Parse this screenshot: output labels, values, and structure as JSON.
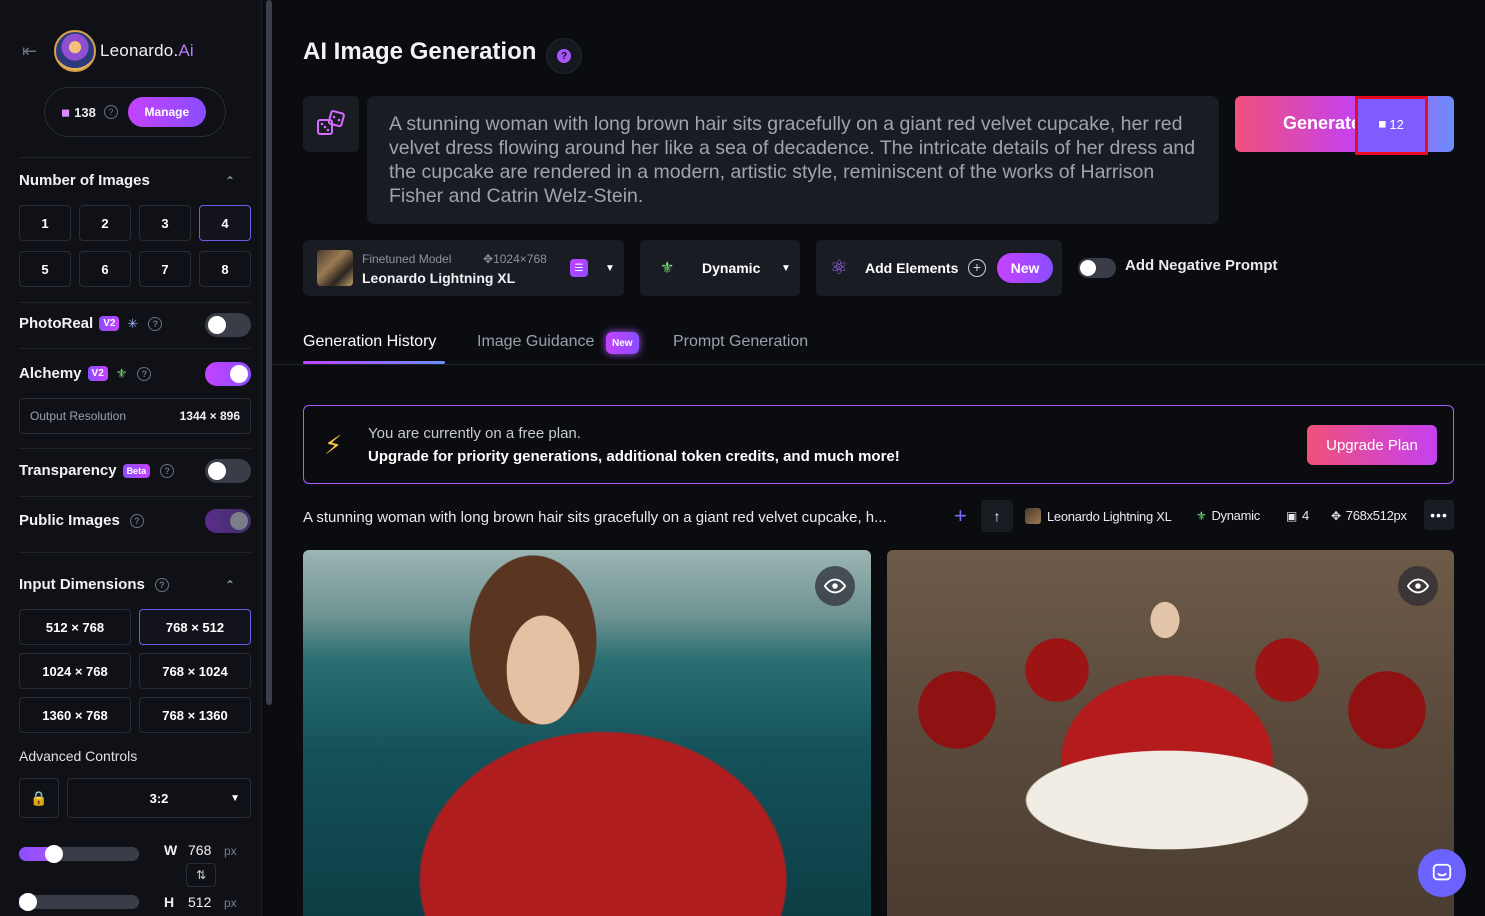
{
  "sidebar": {
    "brand": {
      "name": "Leonardo.",
      "suffix": "Ai"
    },
    "tokens": {
      "count": "138",
      "manage_label": "Manage"
    },
    "number_of_images": {
      "title": "Number of Images",
      "options": [
        "1",
        "2",
        "3",
        "4",
        "5",
        "6",
        "7",
        "8"
      ],
      "selected": "4"
    },
    "photoreal": {
      "label": "PhotoReal",
      "badge": "V2",
      "enabled": false
    },
    "alchemy": {
      "label": "Alchemy",
      "badge": "V2",
      "enabled": true
    },
    "output_resolution": {
      "label": "Output Resolution",
      "value": "1344 × 896"
    },
    "transparency": {
      "label": "Transparency",
      "badge": "Beta",
      "enabled": false
    },
    "public_images": {
      "label": "Public Images",
      "enabled": true
    },
    "input_dimensions": {
      "title": "Input Dimensions",
      "options": [
        "512 × 768",
        "768 × 512",
        "1024 × 768",
        "768 × 1024",
        "1360 × 768",
        "768 × 1360"
      ],
      "selected": "768 × 512"
    },
    "advanced_controls": {
      "label": "Advanced Controls",
      "aspect_ratio": "3:2"
    },
    "width": {
      "letter": "W",
      "value": "768",
      "unit": "px",
      "level": 0.25
    },
    "height": {
      "letter": "H",
      "value": "512",
      "unit": "px",
      "level": 0.0
    }
  },
  "main": {
    "title": "AI Image Generation",
    "prompt": "A stunning woman with long brown hair sits gracefully on a giant red velvet cupcake, her red velvet dress flowing around her like a sea of decadence. The intricate details of her dress and the cupcake are rendered in a modern, artistic style, reminiscent of the works of Harrison Fisher and Catrin Welz-Stein.",
    "generate": {
      "label": "Generate",
      "cost": "12"
    },
    "model": {
      "subtitle": "Finetuned Model",
      "resolution": "1024×768",
      "name": "Leonardo Lightning XL"
    },
    "style": {
      "label": "Dynamic"
    },
    "elements": {
      "label": "Add Elements",
      "badge": "New"
    },
    "negative_prompt": {
      "label": "Add Negative Prompt",
      "enabled": false
    },
    "tabs": [
      {
        "label": "Generation History",
        "active": true
      },
      {
        "label": "Image Guidance",
        "badge": "New",
        "active": false
      },
      {
        "label": "Prompt Generation",
        "active": false
      }
    ],
    "plan_banner": {
      "line1": "You are currently on a free plan.",
      "line2": "Upgrade for priority generations, additional token credits, and much more!",
      "button": "Upgrade Plan"
    },
    "generation": {
      "prompt_preview": "A stunning woman with long brown hair sits gracefully on a giant red velvet cupcake, h...",
      "model": "Leonardo Lightning XL",
      "style": "Dynamic",
      "count": "4",
      "dimensions": "768x512px"
    }
  },
  "colors": {
    "accent_purple": "#a855f7",
    "accent_pink": "#f0507a",
    "highlight_red": "#ee0a1e"
  }
}
